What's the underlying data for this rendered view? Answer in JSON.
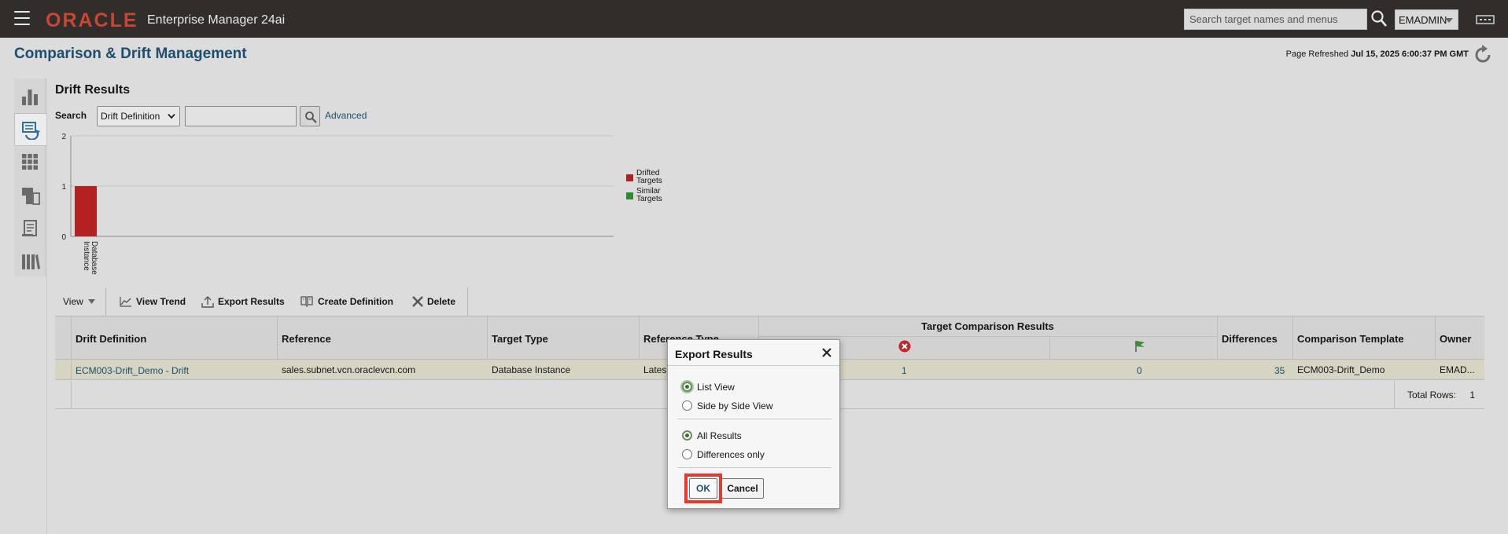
{
  "header": {
    "logo": "ORACLE",
    "product": "Enterprise Manager 24ai",
    "search_placeholder": "Search target names and menus",
    "user": "EMADMIN"
  },
  "page": {
    "title": "Comparison & Drift Management",
    "refresh_label": "Page Refreshed",
    "refresh_time": "Jul 15, 2025 6:00:37 PM GMT"
  },
  "left_nav": [
    {
      "icon": "bar-chart-icon"
    },
    {
      "icon": "drift-icon",
      "active": true
    },
    {
      "icon": "grid-icon"
    },
    {
      "icon": "documents-icon"
    },
    {
      "icon": "report-icon"
    },
    {
      "icon": "library-icon"
    }
  ],
  "drift": {
    "title": "Drift Results",
    "search_label": "Search",
    "search_select": "Drift Definition",
    "search_value": "",
    "advanced": "Advanced"
  },
  "chart_data": {
    "type": "bar",
    "categories": [
      "Database Instance"
    ],
    "series": [
      {
        "name": "Drifted Targets",
        "values": [
          1
        ],
        "color": "#b22222"
      },
      {
        "name": "Similar Targets",
        "values": [
          0
        ],
        "color": "#2e8b2e"
      }
    ],
    "ylim": [
      0,
      2
    ],
    "yticks": [
      "0",
      "1",
      "2"
    ],
    "legend": "right",
    "grid": true
  },
  "toolbar": {
    "view": "View",
    "view_trend": "View Trend",
    "export": "Export Results",
    "create": "Create Definition",
    "delete": "Delete"
  },
  "table": {
    "headers": {
      "definition": "Drift Definition",
      "reference": "Reference",
      "target_type": "Target Type",
      "reference_type": "Reference Type",
      "comparison_results": "Target Comparison Results",
      "differences": "Differences",
      "template": "Comparison Template",
      "owner": "Owner"
    },
    "rows": [
      {
        "definition": "ECM003-Drift_Demo - Drift",
        "reference": "sales.subnet.vcn.oraclevcn.com",
        "target_type": "Database Instance",
        "reference_type": "Lates",
        "drifted": "1",
        "similar": "0",
        "differences": "35",
        "template": "ECM003-Drift_Demo",
        "owner": "EMAD..."
      }
    ],
    "total_rows_label": "Total Rows:",
    "total_rows": "1"
  },
  "modal": {
    "title": "Export Results",
    "view_options": [
      "List View",
      "Side by Side View"
    ],
    "view_selected": 0,
    "result_options": [
      "All Results",
      "Differences only"
    ],
    "result_selected": 0,
    "ok": "OK",
    "cancel": "Cancel"
  },
  "colors": {
    "topbar": "#312d2a",
    "oracle_red": "#c74634",
    "title_blue": "#1d4e6e",
    "highlight": "#e8392b"
  }
}
